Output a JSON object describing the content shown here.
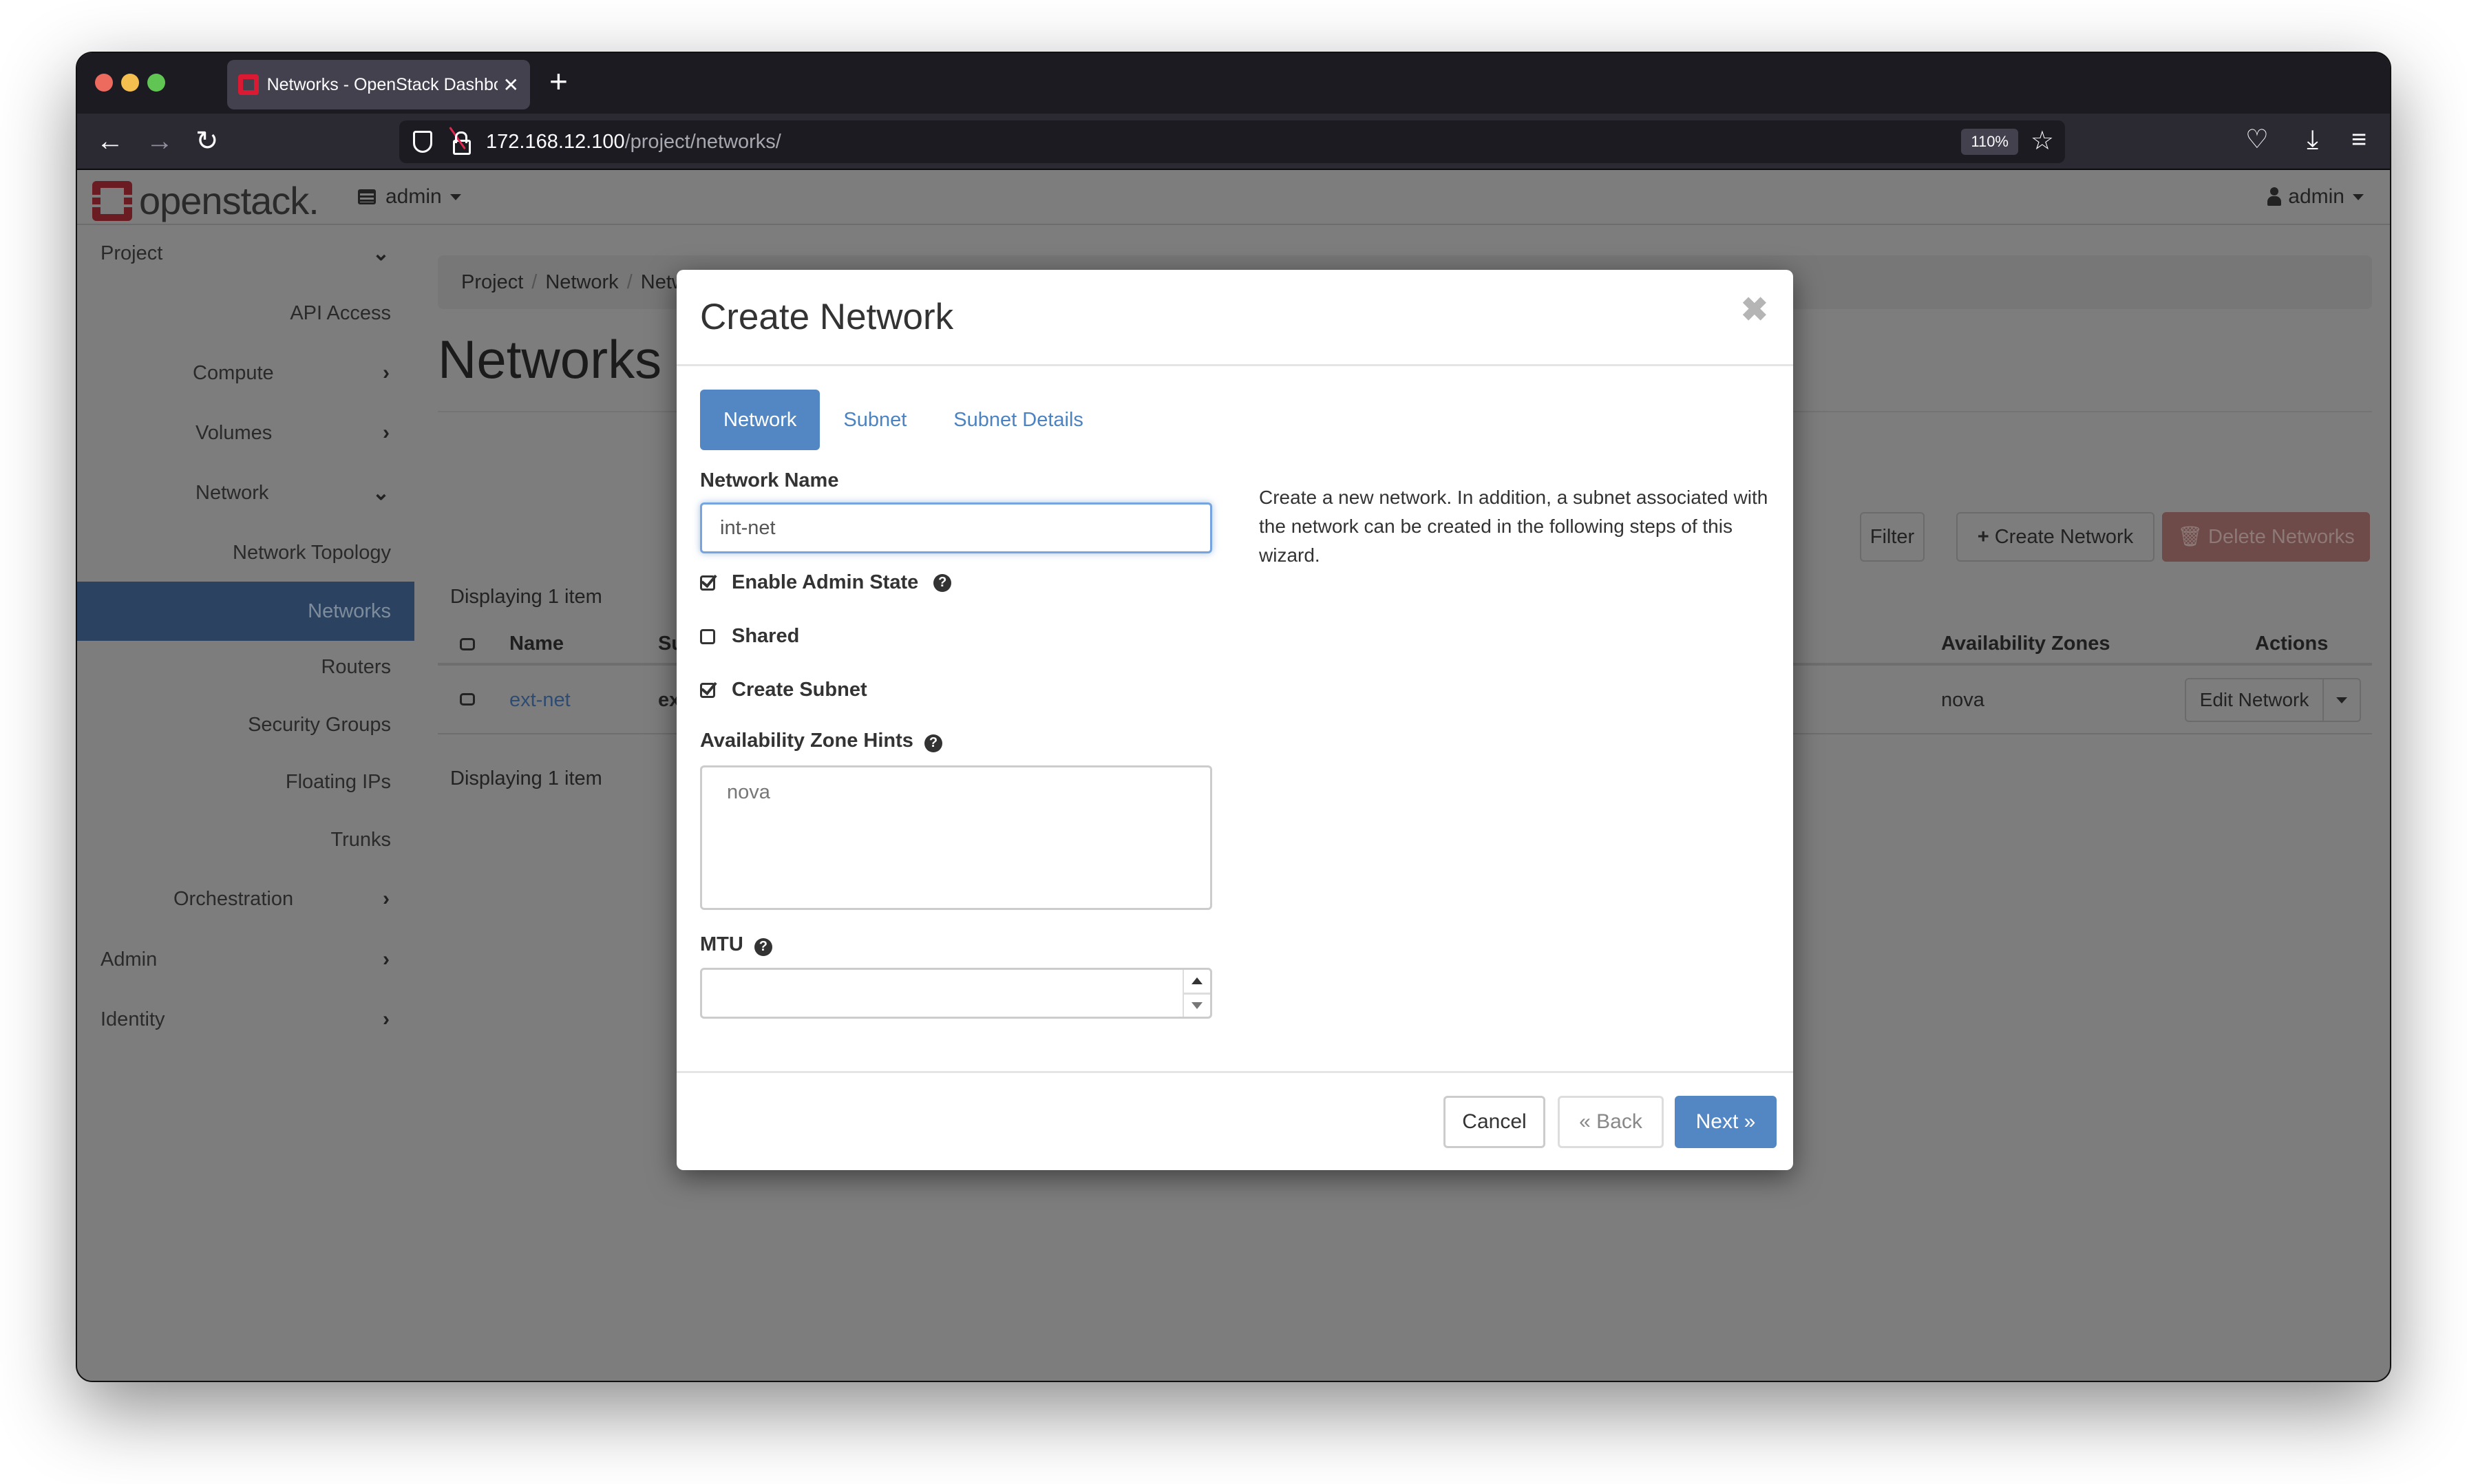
{
  "browser": {
    "tab_title": "Networks - OpenStack Dashboard",
    "url_host": "172.168.12.100",
    "url_path": "/project/networks/",
    "zoom_level": "110%"
  },
  "header": {
    "logo_text": "openstack.",
    "project_selector": "admin",
    "user_menu": "admin"
  },
  "sidebar": {
    "items": [
      {
        "label": "Project",
        "chevron": "down"
      },
      {
        "label": "API Access"
      },
      {
        "label": "Compute",
        "chevron": "right"
      },
      {
        "label": "Volumes",
        "chevron": "right"
      },
      {
        "label": "Network",
        "chevron": "down"
      },
      {
        "label": "Network Topology"
      },
      {
        "label": "Networks",
        "active": true
      },
      {
        "label": "Routers"
      },
      {
        "label": "Security Groups"
      },
      {
        "label": "Floating IPs"
      },
      {
        "label": "Trunks"
      },
      {
        "label": "Orchestration",
        "chevron": "right"
      },
      {
        "label": "Admin",
        "chevron": "right"
      },
      {
        "label": "Identity",
        "chevron": "right"
      }
    ]
  },
  "main": {
    "breadcrumb": [
      "Project",
      "Network",
      "Networks"
    ],
    "page_title": "Networks",
    "filter_button": "Filter",
    "create_button": "Create Network",
    "delete_button": "Delete Networks",
    "count_top": "Displaying 1 item",
    "count_bottom": "Displaying 1 item",
    "table": {
      "columns": [
        "Name",
        "Subnets Associated",
        "Availability Zones",
        "Actions"
      ],
      "rows": [
        {
          "name": "ext-net",
          "subnets": "ext-subnet",
          "availability_zones": "nova",
          "action": "Edit Network"
        }
      ]
    }
  },
  "modal": {
    "title": "Create Network",
    "tabs": [
      "Network",
      "Subnet",
      "Subnet Details"
    ],
    "active_tab": "Network",
    "network_name_label": "Network Name",
    "network_name_value": "int-net",
    "enable_admin_state_label": "Enable Admin State",
    "enable_admin_state_checked": true,
    "shared_label": "Shared",
    "shared_checked": false,
    "create_subnet_label": "Create Subnet",
    "create_subnet_checked": true,
    "az_hints_label": "Availability Zone Hints",
    "az_hints_options": [
      "nova"
    ],
    "mtu_label": "MTU",
    "mtu_value": "",
    "description": "Create a new network. In addition, a subnet associated with the network can be created in the following steps of this wizard.",
    "cancel_button": "Cancel",
    "back_button": "« Back",
    "next_button": "Next »"
  },
  "colors": {
    "primary": "#5387c4",
    "danger": "#c9302c",
    "sidebar_active": "#2b4360"
  }
}
